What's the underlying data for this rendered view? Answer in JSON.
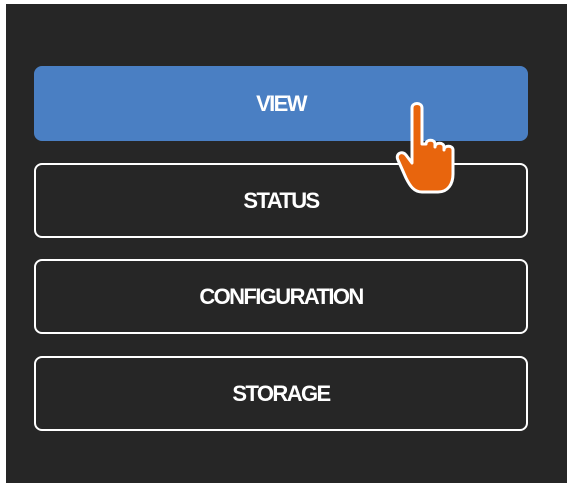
{
  "menu": {
    "items": [
      {
        "label": "VIEW",
        "active": true
      },
      {
        "label": "STATUS",
        "active": false
      },
      {
        "label": "CONFIGURATION",
        "active": false
      },
      {
        "label": "STORAGE",
        "active": false
      }
    ]
  },
  "cursor": {
    "icon": "hand-pointer-icon",
    "color": "#e8650d",
    "outline": "#ffffff"
  },
  "colors": {
    "panel_background": "#262626",
    "active_button": "#4a7fc3",
    "button_border": "#ffffff",
    "text": "#ffffff"
  }
}
